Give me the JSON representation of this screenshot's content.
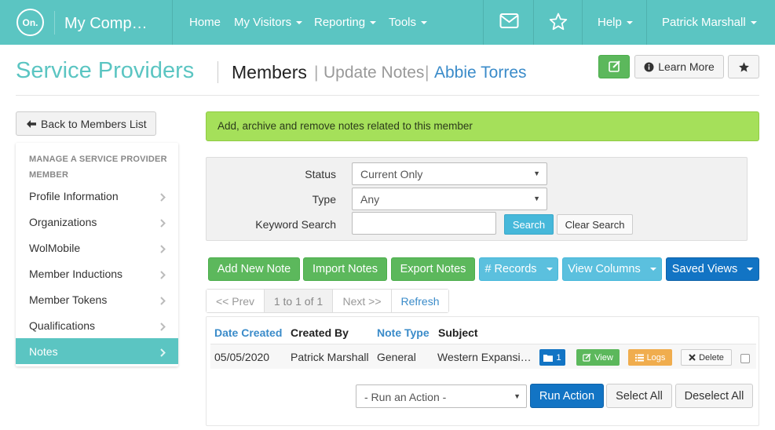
{
  "topnav": {
    "logo_text": "On.",
    "app_name": "My Comp…",
    "items": [
      "Home",
      "My Visitors",
      "Reporting",
      "Tools"
    ],
    "help": "Help",
    "user": "Patrick Marshall",
    "icons": [
      "envelope-icon",
      "star-icon"
    ]
  },
  "header": {
    "title": "Service Providers",
    "crumb_members": "Members",
    "crumb_sep": "|",
    "crumb_notes": "Update Notes",
    "crumb_name": "Abbie Torres",
    "learn_more": "Learn More"
  },
  "sidebar": {
    "back": "Back to Members List",
    "heading": "MANAGE A SERVICE PROVIDER MEMBER",
    "items": [
      "Profile Information",
      "Organizations",
      "WolMobile",
      "Member Inductions",
      "Member Tokens",
      "Qualifications",
      "Notes"
    ],
    "active": "Notes"
  },
  "alert": "Add, archive and remove notes related to this member",
  "filters": {
    "status_label": "Status",
    "status_value": "Current Only",
    "type_label": "Type",
    "type_value": "Any",
    "keyword_label": "Keyword Search",
    "search": "Search",
    "clear": "Clear Search"
  },
  "actions": {
    "add": "Add New Note",
    "import": "Import Notes",
    "export": "Export Notes",
    "records": "# Records",
    "columns": "View Columns",
    "saved": "Saved Views"
  },
  "pager": {
    "prev": "<< Prev",
    "info": "1 to 1 of 1",
    "next": "Next >>",
    "refresh": "Refresh"
  },
  "table": {
    "headers": [
      "Date Created",
      "Created By",
      "Note Type",
      "Subject"
    ],
    "rows": [
      {
        "date": "05/05/2020",
        "created_by": "Patrick Marshall",
        "type": "General",
        "subject": "Western Expansi…",
        "files": "1",
        "view": "View",
        "logs": "Logs",
        "delete": "Delete"
      }
    ]
  },
  "footer": {
    "action_placeholder": "- Run an Action -",
    "run": "Run Action",
    "select_all": "Select All",
    "deselect_all": "Deselect All"
  },
  "colors": {
    "brand_teal": "#5bc5c2",
    "success": "#5cb85c",
    "info": "#5bc0de",
    "primary": "#1274c4",
    "alert_green": "#a5e05a",
    "link": "#3a8bc9"
  }
}
